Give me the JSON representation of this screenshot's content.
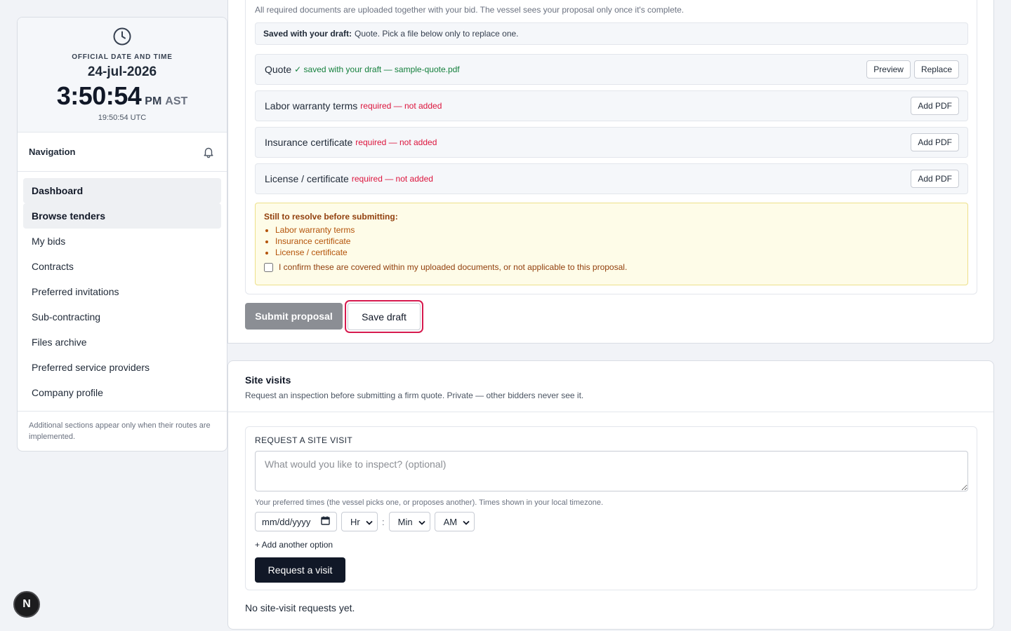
{
  "sidebar": {
    "clock": {
      "label": "OFFICIAL DATE AND TIME",
      "date": "24-jul-2026",
      "time": "3:50:54",
      "ampm": "PM",
      "tz": "AST",
      "utc": "19:50:54 UTC"
    },
    "nav_title": "Navigation",
    "items": [
      {
        "label": "Dashboard"
      },
      {
        "label": "Browse tenders"
      },
      {
        "label": "My bids"
      },
      {
        "label": "Contracts"
      },
      {
        "label": "Preferred invitations"
      },
      {
        "label": "Sub-contracting"
      },
      {
        "label": "Files archive"
      },
      {
        "label": "Preferred service providers"
      },
      {
        "label": "Company profile"
      }
    ],
    "footer_note": "Additional sections appear only when their routes are implemented."
  },
  "documents": {
    "intro": "All required documents are uploaded together with your bid. The vessel sees your proposal only once it's complete.",
    "saved_label": "Saved with your draft:",
    "saved_text": "Quote. Pick a file below only to replace one.",
    "rows": [
      {
        "name": "Quote",
        "status": "✓ saved with your draft — sample-quote.pdf",
        "preview": "Preview",
        "replace": "Replace"
      },
      {
        "name": "Labor warranty terms",
        "status": "required — not added",
        "action": "Add PDF"
      },
      {
        "name": "Insurance certificate",
        "status": "required — not added",
        "action": "Add PDF"
      },
      {
        "name": "License / certificate",
        "status": "required — not added",
        "action": "Add PDF"
      }
    ],
    "warning": {
      "title": "Still to resolve before submitting:",
      "items": [
        "Labor warranty terms",
        "Insurance certificate",
        "License / certificate"
      ],
      "confirm": "I confirm these are covered within my uploaded documents, or not applicable to this proposal."
    },
    "submit_label": "Submit proposal",
    "save_label": "Save draft"
  },
  "site_visits": {
    "title": "Site visits",
    "description": "Request an inspection before submitting a firm quote. Private — other bidders never see it.",
    "form_title": "REQUEST A SITE VISIT",
    "textarea_placeholder": "What would you like to inspect? (optional)",
    "hint": "Your preferred times (the vessel picks one, or proposes another). Times shown in your local timezone.",
    "date_placeholder": "mm/dd/yyyy",
    "hour": "Hr",
    "minute": "Min",
    "ampm": "AM",
    "colon": ":",
    "add_option": "+ Add another option",
    "request_label": "Request a visit",
    "empty": "No site-visit requests yet."
  },
  "badge": {
    "letter": "N"
  }
}
